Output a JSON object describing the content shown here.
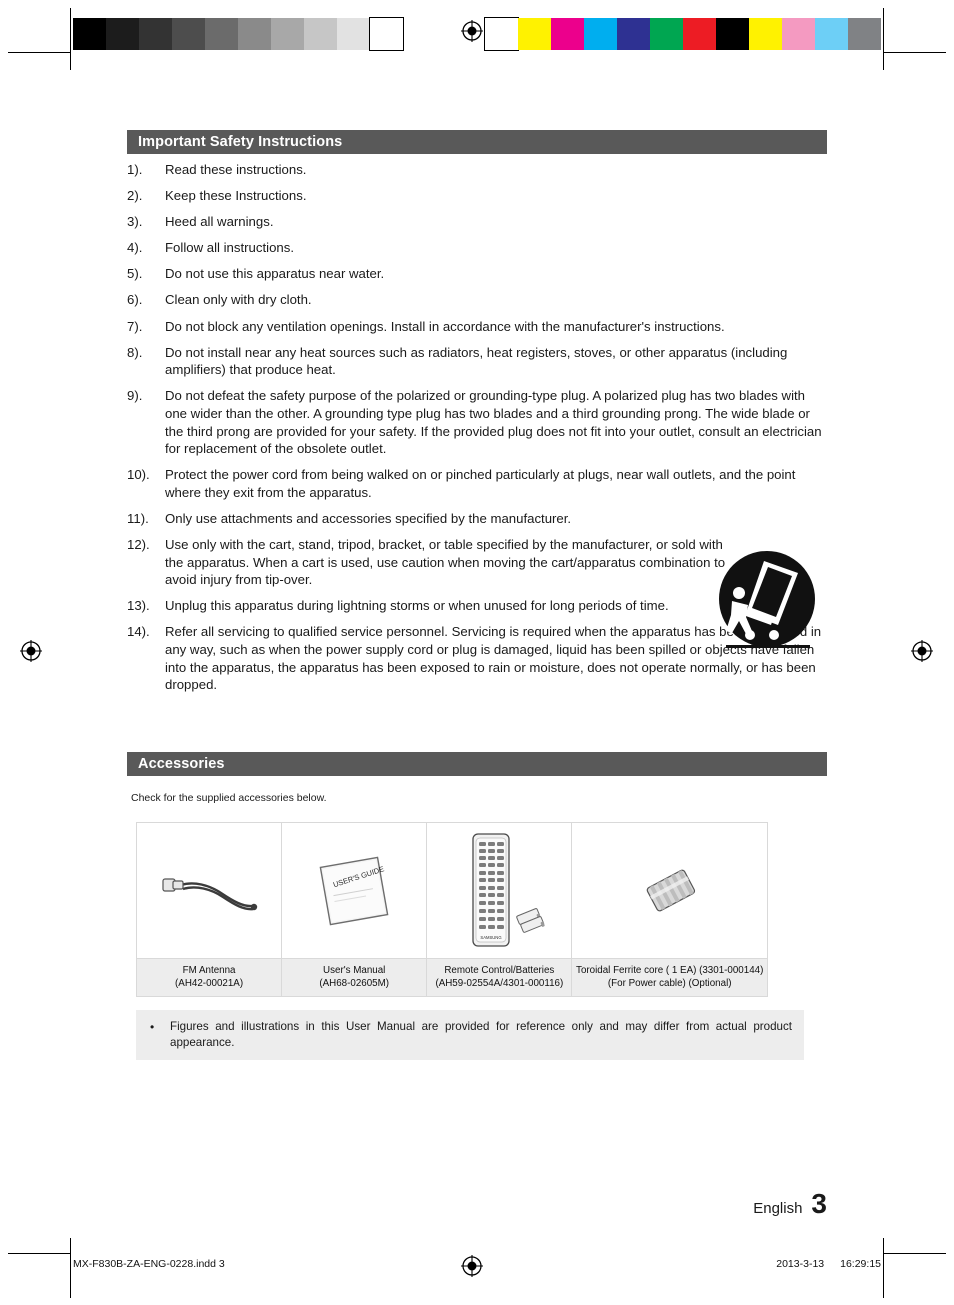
{
  "document": {
    "safety": {
      "heading": "Important Safety Instructions",
      "items": [
        {
          "num": "1).",
          "text": "Read these instructions."
        },
        {
          "num": "2).",
          "text": "Keep these Instructions."
        },
        {
          "num": "3).",
          "text": "Heed all warnings."
        },
        {
          "num": "4).",
          "text": "Follow all instructions."
        },
        {
          "num": "5).",
          "text": "Do not use this apparatus near water."
        },
        {
          "num": "6).",
          "text": "Clean only with dry cloth."
        },
        {
          "num": "7).",
          "text": "Do not block any ventilation openings. Install in accordance with the manufacturer's instructions."
        },
        {
          "num": "8).",
          "text": "Do not install near any heat sources such as radiators, heat registers, stoves, or other apparatus (including amplifiers) that produce heat."
        },
        {
          "num": "9).",
          "text": "Do not defeat the safety purpose of the polarized or grounding-type plug. A polarized plug has two blades with one wider than the other. A grounding type plug has two blades and a third grounding prong. The wide blade or the third prong are provided for your safety. If the provided plug does not fit into your outlet, consult an electrician for replacement of the obsolete outlet."
        },
        {
          "num": "10).",
          "text": "Protect the power cord from being walked on or pinched particularly at plugs, near wall outlets, and the point where they exit from the apparatus."
        },
        {
          "num": "11).",
          "text": "Only use attachments and accessories specified by the manufacturer."
        },
        {
          "num": "12).",
          "text": "Use only with the cart, stand, tripod, bracket, or table specified by the manufacturer, or sold with the apparatus. When a cart is used, use caution when moving the cart/apparatus combination to avoid injury from tip-over."
        },
        {
          "num": "13).",
          "text": "Unplug this apparatus during lightning storms or when unused for long periods of time."
        },
        {
          "num": "14).",
          "text": "Refer all servicing to qualified service personnel. Servicing is required when the apparatus has been damaged in any way, such as when the power supply cord or plug is damaged, liquid has been spilled or objects have fallen into the apparatus, the apparatus has been exposed to rain or moisture, does not operate normally, or has been dropped."
        }
      ]
    },
    "accessories": {
      "heading": "Accessories",
      "check_note": "Check for the supplied accessories below.",
      "items": [
        {
          "name": "FM Antenna",
          "code": "(AH42-00021A)"
        },
        {
          "name": "User's Manual",
          "code": "(AH68-02605M)"
        },
        {
          "name": "Remote Control/Batteries",
          "code": "(AH59-02554A/4301-000116)"
        },
        {
          "name": "Toroidal Ferrite core ( 1 EA) (3301-000144)",
          "code": "(For Power cable) (Optional)"
        }
      ],
      "manual_cover_text": "USER'S GUIDE",
      "remote_brand": "SAMSUNG",
      "note_bullet": "•",
      "note": "Figures and illustrations in this User Manual are provided for reference only and may differ from actual product appearance."
    },
    "footer": {
      "language": "English",
      "page_number": "3",
      "print_file": "MX-F830B-ZA-ENG-0228.indd   3",
      "print_date": "2013-3-13",
      "print_time": "16:29:15"
    },
    "print_marks": {
      "greyscale": [
        "#000000",
        "#1c1c1c",
        "#333333",
        "#4d4d4d",
        "#6b6b6b",
        "#8a8a8a",
        "#a8a8a8",
        "#c6c6c6",
        "#e2e2e2",
        "#ffffff"
      ],
      "colorbar": [
        "#ffffff",
        "#fff200",
        "#ec008c",
        "#00aeef",
        "#2e3192",
        "#00a651",
        "#ed1c24",
        "#000000",
        "#fff200",
        "#f49ac1",
        "#6dcff6",
        "#808285"
      ]
    }
  }
}
